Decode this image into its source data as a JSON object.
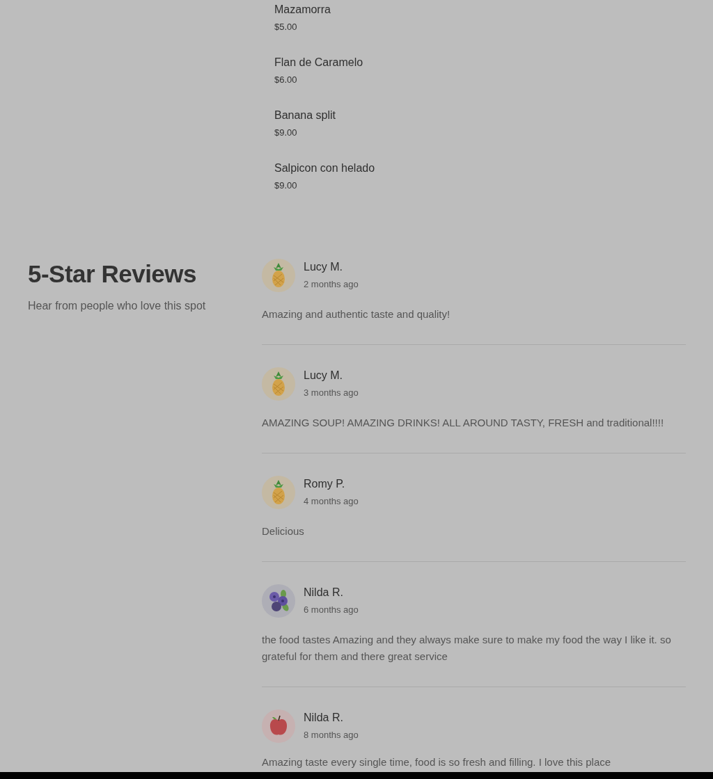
{
  "menu_items": [
    {
      "name": "Mazamorra",
      "price": "$5.00"
    },
    {
      "name": "Flan de Caramelo",
      "price": "$6.00"
    },
    {
      "name": "Banana split",
      "price": "$9.00"
    },
    {
      "name": "Salpicon con helado",
      "price": "$9.00"
    }
  ],
  "reviews_section": {
    "title": "5-Star Reviews",
    "subtitle": "Hear from people who love this spot"
  },
  "reviews": [
    {
      "kind": "pineapple",
      "name": "Lucy M.",
      "time": "2 months ago",
      "text": "Amazing and authentic taste and quality!"
    },
    {
      "kind": "pineapple",
      "name": "Lucy M.",
      "time": "3 months ago",
      "text": "AMAZING SOUP! AMAZING DRINKS! ALL AROUND TASTY, FRESH and traditional!!!!"
    },
    {
      "kind": "pineapple",
      "name": "Romy P.",
      "time": "4 months ago",
      "text": "Delicious"
    },
    {
      "kind": "blueberry",
      "name": "Nilda R.",
      "time": "6 months ago",
      "text": "the food tastes Amazing and they always make sure to make my food the way I like it. so grateful for them and there great service"
    },
    {
      "kind": "apple",
      "name": "Nilda R.",
      "time": "8 months ago",
      "text": "Amazing taste every single time, food is so fresh and filling. I love this place"
    }
  ]
}
